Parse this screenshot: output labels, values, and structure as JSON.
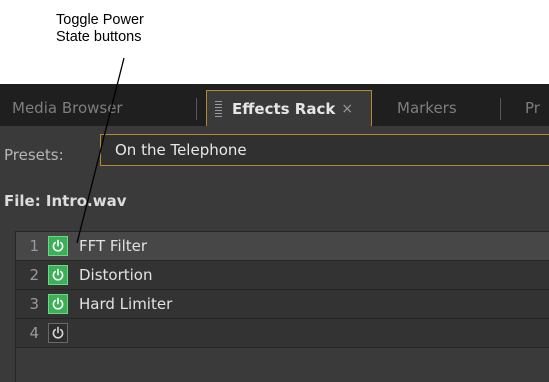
{
  "callout": {
    "line1": "Toggle Power",
    "line2": "State buttons"
  },
  "tabs": [
    {
      "label": "Media Browser",
      "active": false
    },
    {
      "label": "Effects Rack",
      "active": true,
      "close": "×"
    },
    {
      "label": "Markers",
      "active": false
    },
    {
      "label": "Pr",
      "active": false
    }
  ],
  "presets": {
    "label": "Presets:",
    "value": "On the Telephone"
  },
  "file": {
    "label": "File: Intro.wav"
  },
  "rack": {
    "slots": [
      {
        "index": "1",
        "name": "FFT Filter",
        "power": "on",
        "selected": true
      },
      {
        "index": "2",
        "name": "Distortion",
        "power": "on",
        "selected": false
      },
      {
        "index": "3",
        "name": "Hard Limiter",
        "power": "on",
        "selected": false
      },
      {
        "index": "4",
        "name": "",
        "power": "off",
        "selected": false
      }
    ]
  },
  "colors": {
    "accent_border": "#b5882d",
    "power_on": "#3bb058",
    "panel_bg": "#3a3a3a"
  }
}
